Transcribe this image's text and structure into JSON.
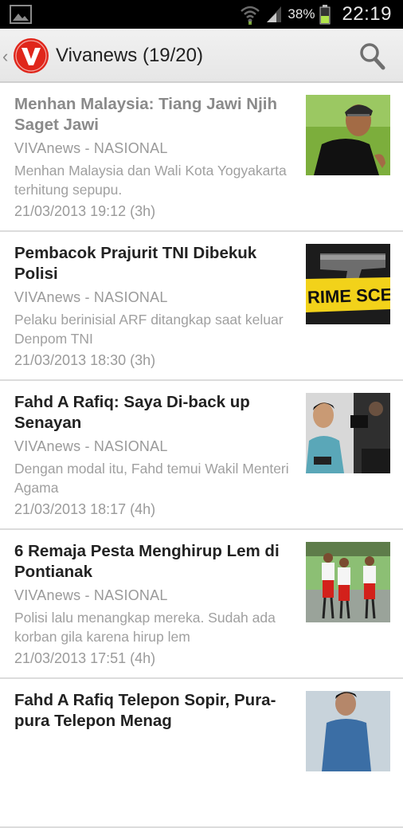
{
  "status_bar": {
    "battery_percent": "38%",
    "time": "22:19",
    "icons": [
      "gallery-notification-icon",
      "wifi-icon",
      "signal-icon",
      "battery-icon"
    ]
  },
  "action_bar": {
    "title": "Vivanews (19/20)",
    "logo_letter": "V",
    "brand_color": "#e0261b",
    "search_icon": "search-icon"
  },
  "articles": [
    {
      "title": "Menhan Malaysia: Tiang Jawi Njih Saget Jawi",
      "source": "VIVAnews - NASIONAL",
      "summary": "Menhan Malaysia dan Wali Kota Yogyakarta terhitung sepupu.",
      "time": "21/03/2013 19:12 (3h)",
      "read": true,
      "thumbnail": "man-in-black-cap-photo"
    },
    {
      "title": "Pembacok Prajurit TNI Dibekuk Polisi",
      "source": "VIVAnews - NASIONAL",
      "summary": "Pelaku berinisial ARF ditangkap saat keluar Denpom TNI",
      "time": "21/03/2013 18:30 (3h)",
      "read": false,
      "thumbnail": "crime-scene-tape-photo",
      "thumbnail_text": "RIME SCENE"
    },
    {
      "title": "Fahd A Rafiq: Saya Di-back up Senayan",
      "source": "VIVAnews - NASIONAL",
      "summary": "Dengan modal itu, Fahd temui Wakil Menteri Agama",
      "time": "21/03/2013 18:17 (4h)",
      "read": false,
      "thumbnail": "press-crowd-photo"
    },
    {
      "title": "6 Remaja Pesta Menghirup Lem di Pontianak",
      "source": "VIVAnews - NASIONAL",
      "summary": "Polisi lalu menangkap mereka. Sudah ada korban gila karena hirup lem",
      "time": "21/03/2013 17:51 (4h)",
      "read": false,
      "thumbnail": "students-in-uniform-photo"
    },
    {
      "title": "Fahd A Rafiq Telepon Sopir, Pura-pura Telepon Menag",
      "source": "",
      "summary": "",
      "time": "",
      "read": false,
      "thumbnail": "man-portrait-photo"
    }
  ]
}
